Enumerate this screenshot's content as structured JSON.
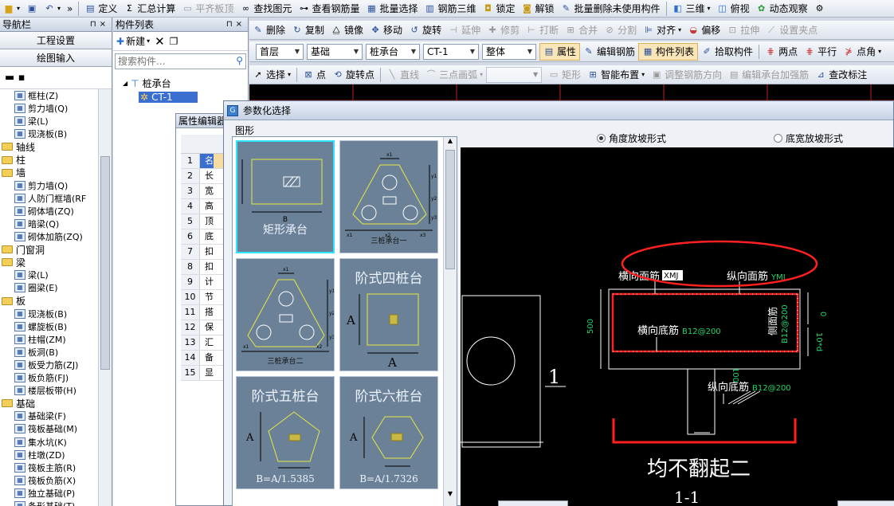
{
  "toolbar1": {
    "items": [
      {
        "label": "定义",
        "disabled": false
      },
      {
        "label": "汇总计算",
        "disabled": false
      },
      {
        "label": "平齐板顶",
        "disabled": true
      },
      {
        "label": "查找图元",
        "disabled": false
      },
      {
        "label": "查看钢筋量",
        "disabled": false
      },
      {
        "label": "批量选择",
        "disabled": false
      },
      {
        "label": "钢筋三维",
        "disabled": false
      },
      {
        "label": "锁定",
        "disabled": false
      },
      {
        "label": "解锁",
        "disabled": false
      },
      {
        "label": "批量删除未使用构件",
        "disabled": false
      },
      {
        "label": "三维",
        "disabled": false
      },
      {
        "label": "俯视",
        "disabled": false
      },
      {
        "label": "动态观察",
        "disabled": false
      }
    ]
  },
  "toolbar2": {
    "items": [
      {
        "label": "删除",
        "disabled": false
      },
      {
        "label": "复制",
        "disabled": false
      },
      {
        "label": "镜像",
        "disabled": false
      },
      {
        "label": "移动",
        "disabled": false
      },
      {
        "label": "旋转",
        "disabled": false
      },
      {
        "label": "延伸",
        "disabled": true
      },
      {
        "label": "修剪",
        "disabled": true
      },
      {
        "label": "打断",
        "disabled": true
      },
      {
        "label": "合并",
        "disabled": true
      },
      {
        "label": "分割",
        "disabled": true
      },
      {
        "label": "对齐",
        "disabled": false
      },
      {
        "label": "偏移",
        "disabled": false
      },
      {
        "label": "拉伸",
        "disabled": true
      },
      {
        "label": "设置夹点",
        "disabled": true
      }
    ]
  },
  "toolbar3": {
    "selects": [
      "首层",
      "基础",
      "桩承台",
      "CT-1",
      "整体"
    ],
    "items": [
      {
        "label": "属性",
        "disabled": false
      },
      {
        "label": "编辑钢筋",
        "disabled": false
      },
      {
        "label": "构件列表",
        "disabled": false
      },
      {
        "label": "拾取构件",
        "disabled": false
      },
      {
        "label": "两点",
        "disabled": false
      },
      {
        "label": "平行",
        "disabled": false
      },
      {
        "label": "点角",
        "disabled": false
      }
    ]
  },
  "toolbar4": {
    "items": [
      {
        "label": "选择",
        "disabled": false
      },
      {
        "label": "点",
        "disabled": false
      },
      {
        "label": "旋转点",
        "disabled": false
      },
      {
        "label": "直线",
        "disabled": true
      },
      {
        "label": "三点画弧",
        "disabled": true
      },
      {
        "label": "矩形",
        "disabled": true
      },
      {
        "label": "智能布置",
        "disabled": false
      },
      {
        "label": "调整钢筋方向",
        "disabled": true
      },
      {
        "label": "编辑承台加强筋",
        "disabled": true
      },
      {
        "label": "查改标注",
        "disabled": false
      }
    ]
  },
  "nav": {
    "title": "导航栏",
    "buttons": [
      "工程设置",
      "绘图输入"
    ],
    "tree": [
      {
        "label": "框柱(Z)",
        "type": "sub"
      },
      {
        "label": "剪力墙(Q)",
        "type": "sub"
      },
      {
        "label": "梁(L)",
        "type": "sub"
      },
      {
        "label": "现浇板(B)",
        "type": "sub"
      },
      {
        "label": "轴线",
        "type": "cat"
      },
      {
        "label": "柱",
        "type": "cat"
      },
      {
        "label": "墙",
        "type": "cat"
      },
      {
        "label": "剪力墙(Q)",
        "type": "sub"
      },
      {
        "label": "人防门框墙(RF",
        "type": "sub"
      },
      {
        "label": "砌体墙(ZQ)",
        "type": "sub"
      },
      {
        "label": "暗梁(Q)",
        "type": "sub"
      },
      {
        "label": "砌体加筋(ZQ)",
        "type": "sub"
      },
      {
        "label": "门窗洞",
        "type": "cat"
      },
      {
        "label": "梁",
        "type": "cat"
      },
      {
        "label": "梁(L)",
        "type": "sub"
      },
      {
        "label": "圈梁(E)",
        "type": "sub"
      },
      {
        "label": "板",
        "type": "cat"
      },
      {
        "label": "现浇板(B)",
        "type": "sub"
      },
      {
        "label": "螺旋板(B)",
        "type": "sub"
      },
      {
        "label": "柱帽(ZM)",
        "type": "sub"
      },
      {
        "label": "板洞(B)",
        "type": "sub"
      },
      {
        "label": "板受力筋(ZJ)",
        "type": "sub"
      },
      {
        "label": "板负筋(FJ)",
        "type": "sub"
      },
      {
        "label": "楼层板带(H)",
        "type": "sub"
      },
      {
        "label": "基础",
        "type": "cat"
      },
      {
        "label": "基础梁(F)",
        "type": "sub"
      },
      {
        "label": "筏板基础(M)",
        "type": "sub"
      },
      {
        "label": "集水坑(K)",
        "type": "sub"
      },
      {
        "label": "柱墩(ZD)",
        "type": "sub"
      },
      {
        "label": "筏板主筋(R)",
        "type": "sub"
      },
      {
        "label": "筏板负筋(X)",
        "type": "sub"
      },
      {
        "label": "独立基础(P)",
        "type": "sub"
      },
      {
        "label": "条形基础(T)",
        "type": "sub"
      }
    ]
  },
  "clist": {
    "title": "构件列表",
    "new_label": "新建",
    "search_placeholder": "搜索构件...",
    "root": "桩承台",
    "child": "CT-1"
  },
  "prop": {
    "title": "属性编辑器",
    "rows": [
      {
        "n": "1",
        "v": "名"
      },
      {
        "n": "2",
        "v": "长"
      },
      {
        "n": "3",
        "v": "宽"
      },
      {
        "n": "4",
        "v": "高"
      },
      {
        "n": "5",
        "v": "顶"
      },
      {
        "n": "6",
        "v": "底"
      },
      {
        "n": "7",
        "v": "扣"
      },
      {
        "n": "8",
        "v": "扣"
      },
      {
        "n": "9",
        "v": "计"
      },
      {
        "n": "10",
        "v": "节"
      },
      {
        "n": "11",
        "v": "搭"
      },
      {
        "n": "12",
        "v": "保"
      },
      {
        "n": "13",
        "v": "汇"
      },
      {
        "n": "14",
        "v": "备"
      },
      {
        "n": "15",
        "v": "显"
      }
    ]
  },
  "dialog": {
    "title": "参数化选择",
    "group_label": "图形",
    "radio1": "角度放坡形式",
    "radio2": "底宽放坡形式",
    "tiles": {
      "t1": "矩形承台",
      "t2": "三桩承台一",
      "t3": "三桩承台二",
      "t4": "阶式四桩台",
      "t5": "阶式五桩台",
      "t6": "阶式六桩台",
      "t5_formula": "B=A/1.5385",
      "t6_formula": "B=A/1.7326",
      "a": "A",
      "b": "B",
      "x1": "x1",
      "x2": "x2",
      "x3": "x3",
      "y1": "y1",
      "y2": "y2",
      "y3": "y3"
    },
    "preview": {
      "label_top_h": "横向面筋",
      "val_top_h": "XMJ",
      "label_top_v": "纵向面筋",
      "val_top_v": "YMJ",
      "label_side": "侧面筋",
      "val_side": "B12@200",
      "label_bot_h": "横向底筋",
      "val_bot_h": "B12@200",
      "label_bot_v": "纵向底筋",
      "val_bot_v": "B12@200",
      "dim_500": "500",
      "dim_0": "0",
      "dim_10d": "10*d",
      "dim_100": "100",
      "section": "1",
      "caption": "均不翻起二",
      "caption2": "1-1"
    }
  },
  "colors": {
    "canvas": "#000000",
    "tile_bg": "#6a8197",
    "tile_selected": "#2ee4ff",
    "rebar_red": "#ff2020",
    "dim_green": "#21d36a",
    "outline_yellow": "#e8e844"
  }
}
